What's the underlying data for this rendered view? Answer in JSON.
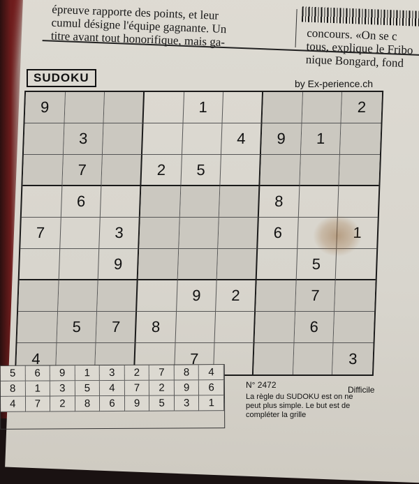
{
  "article": {
    "col1_line1": "épreuve rapporte des points, et leur",
    "col1_line2": "cumul désigne l'équipe gagnante. Un",
    "col1_line3": "titre avant tout honorifique, mais ga-",
    "col2_line1": "concours. «On se c",
    "col2_line2": "tous, explique le Fribo",
    "col2_line3": "nique Bongard, fond"
  },
  "puzzle": {
    "title": "SUDOKU",
    "credit": "by Ex-perience.ch",
    "number": "N° 2472",
    "difficulty": "Difficile",
    "rules_line1": "La règle du SUDOKU est on ne",
    "rules_line2": "peut plus simple. Le but est de",
    "rules_line3": "compléter la grille",
    "grid": [
      [
        "9",
        "",
        "",
        "",
        "1",
        "",
        "",
        "",
        "2"
      ],
      [
        "",
        "3",
        "",
        "",
        "",
        "4",
        "9",
        "1",
        ""
      ],
      [
        "",
        "7",
        "",
        "2",
        "5",
        "",
        "",
        "",
        ""
      ],
      [
        "",
        "6",
        "",
        "",
        "",
        "",
        "8",
        "",
        ""
      ],
      [
        "7",
        "",
        "3",
        "",
        "",
        "",
        "6",
        "",
        "1"
      ],
      [
        "",
        "",
        "9",
        "",
        "",
        "",
        "",
        "5",
        ""
      ],
      [
        "",
        "",
        "",
        "",
        "9",
        "2",
        "",
        "7",
        ""
      ],
      [
        "",
        "5",
        "7",
        "8",
        "",
        "",
        "",
        "6",
        ""
      ],
      [
        "4",
        "",
        "",
        "",
        "7",
        "",
        "",
        "",
        "3"
      ]
    ],
    "solution_rows": [
      [
        "5",
        "6",
        "9",
        "1",
        "3",
        "2",
        "7",
        "8",
        "4"
      ],
      [
        "8",
        "1",
        "3",
        "5",
        "4",
        "7",
        "2",
        "9",
        "6"
      ],
      [
        "4",
        "7",
        "2",
        "8",
        "6",
        "9",
        "5",
        "3",
        "1"
      ]
    ]
  },
  "colors": {
    "paper": "#d9d6cf",
    "ink": "#111111",
    "shade": "#cbc8c0",
    "stain": "#8c5a28"
  }
}
